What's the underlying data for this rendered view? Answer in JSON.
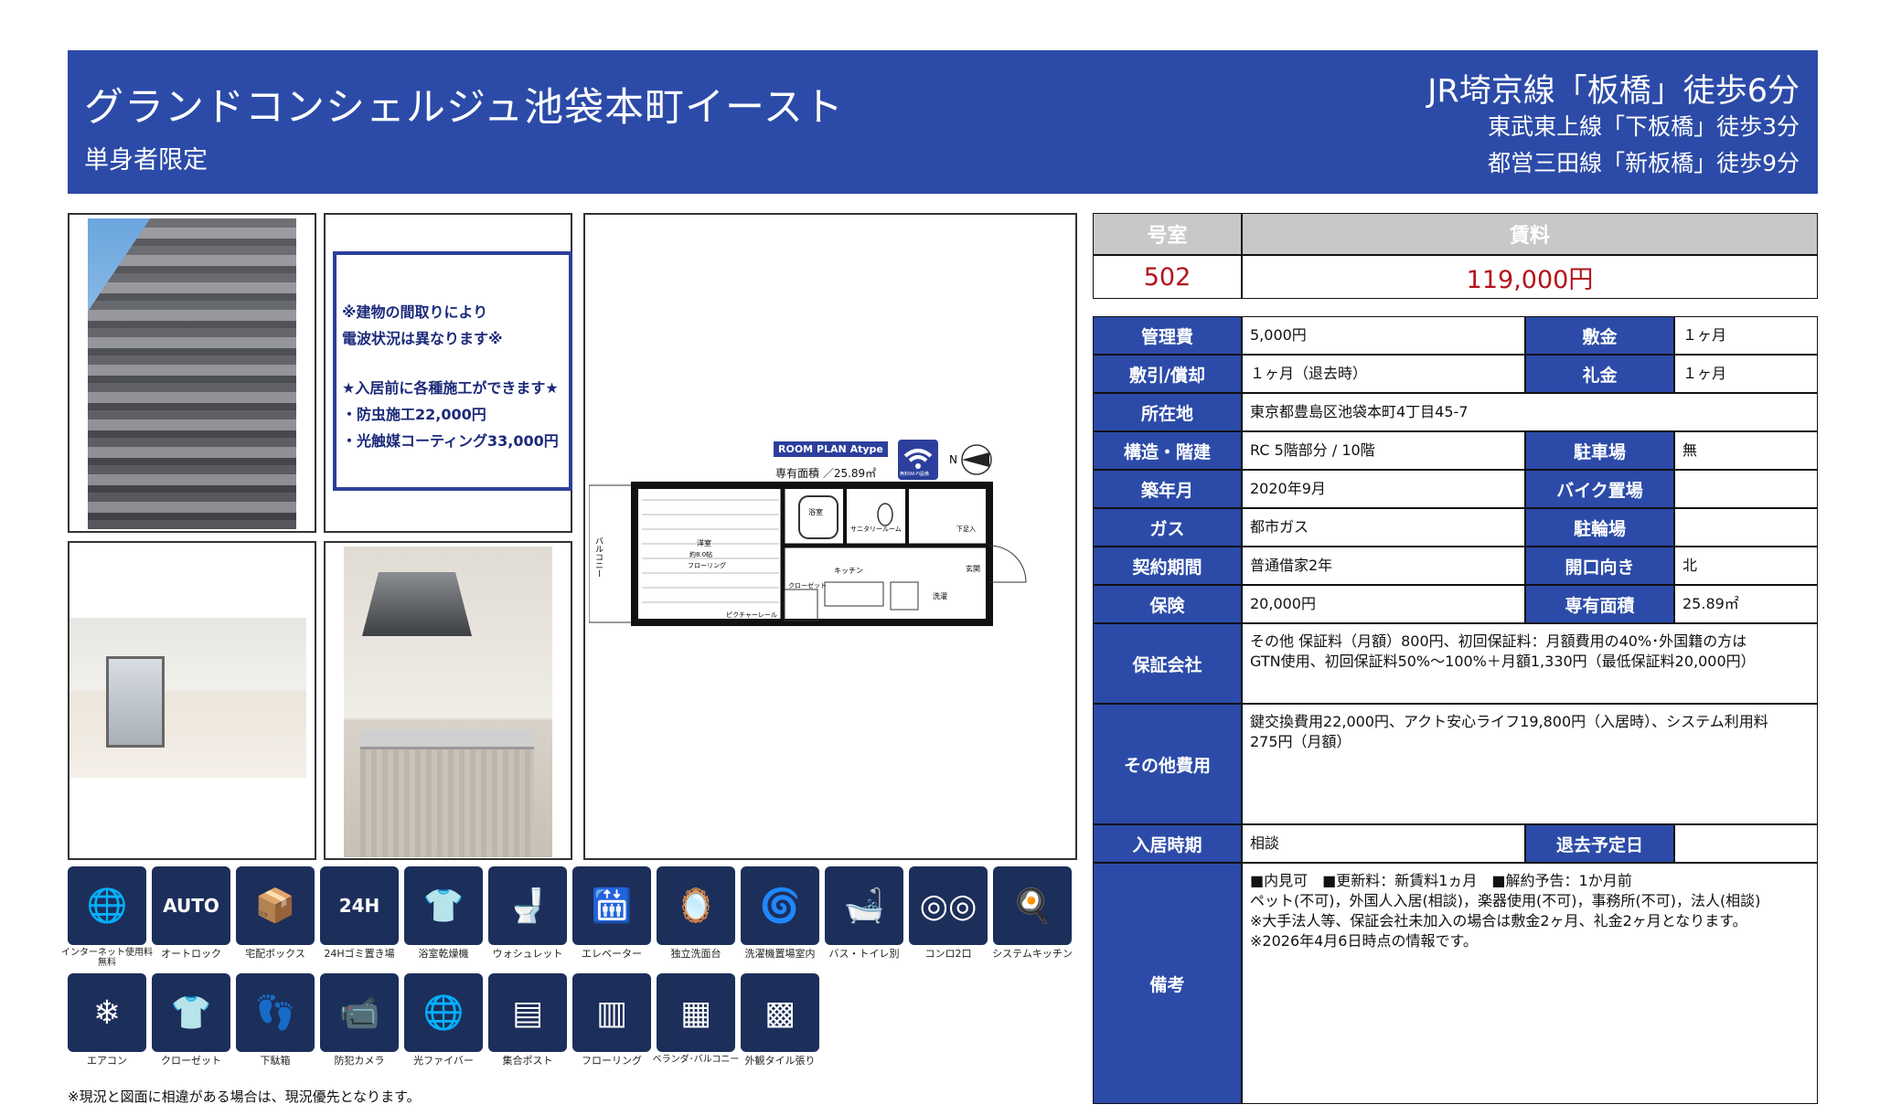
{
  "header": {
    "title": "グランドコンシェルジュ池袋本町イースト",
    "subtitle": "単身者限定",
    "stations": [
      "JR埼京線「板橋」徒歩6分",
      "東武東上線「下板橋」徒歩3分",
      "都営三田線「新板橋」徒歩9分"
    ]
  },
  "notice": {
    "lines": [
      "※建物の間取りにより",
      "電波状況は異なります※",
      "★入居前に各種施工ができます★",
      "・防虫施工22,000円",
      "・光触媒コーティング33,000円"
    ]
  },
  "plan": {
    "tag": "ROOM PLAN  Atype",
    "area": "専有面積 ／25.89㎡",
    "labels": {
      "room": "洋室",
      "room_size": "約8.0帖",
      "flooring": "フローリング",
      "bath": "浴室",
      "sanitary": "サニタリールーム",
      "kitchen": "キッチン",
      "closet": "クローゼット",
      "picture_rail": "ピクチャーレール",
      "balcony": "バルコニー",
      "entrance": "玄関",
      "washer": "洗濯",
      "shoe": "下足入",
      "wifi": "無料Wi-Fi設備"
    }
  },
  "price_table": {
    "room_header": "号室",
    "rent_header": "賃料",
    "room": "502",
    "rent": "119,000円"
  },
  "details": {
    "management_fee": {
      "label": "管理費",
      "value": "5,000円"
    },
    "deposit": {
      "label": "敷金",
      "value": "１ヶ月"
    },
    "shikibiki": {
      "label": "敷引/償却",
      "value": "１ヶ月（退去時）"
    },
    "key_money": {
      "label": "礼金",
      "value": "１ヶ月"
    },
    "address": {
      "label": "所在地",
      "value": "東京都豊島区池袋本町4丁目45-7"
    },
    "structure": {
      "label": "構造・階建",
      "value": "RC 5階部分 / 10階"
    },
    "parking": {
      "label": "駐車場",
      "value": "無"
    },
    "built": {
      "label": "築年月",
      "value": "2020年9月"
    },
    "bike_parking": {
      "label": "バイク置場",
      "value": ""
    },
    "gas": {
      "label": "ガス",
      "value": "都市ガス"
    },
    "bicycle_parking": {
      "label": "駐輪場",
      "value": ""
    },
    "contract": {
      "label": "契約期間",
      "value": "普通借家2年"
    },
    "direction": {
      "label": "開口向き",
      "value": "北"
    },
    "insurance": {
      "label": "保険",
      "value": "20,000円"
    },
    "floor_area": {
      "label": "専有面積",
      "value": "25.89㎡"
    },
    "guarantor": {
      "label": "保証会社",
      "value": "その他 保証料（月額）800円、初回保証料：月額費用の40%･外国籍の方は\nGTN使用、初回保証料50%～100%＋月額1,330円（最低保証料20,000円）"
    },
    "other_fees": {
      "label": "その他費用",
      "value": "鍵交換費用22,000円、アクト安心ライフ19,800円（入居時）、システム利用料\n275円（月額）"
    },
    "move_in": {
      "label": "入居時期",
      "value": "相談"
    },
    "move_out": {
      "label": "退去予定日",
      "value": ""
    },
    "remarks": {
      "label": "備考",
      "value": "■内見可　■更新料：新賃料1ヵ月　■解約予告：1か月前\nペット(不可)，外国人入居(相談)，楽器使用(不可)，事務所(不可)，法人(相談)\n※大手法人等、保証会社未加入の場合は敷金2ヶ月、礼金2ヶ月となります。\n※2026年4月6日時点の情報です。"
    }
  },
  "amenities": [
    {
      "name": "internet-icon",
      "glyph": "🌐",
      "label": "インターネット使用料無料"
    },
    {
      "name": "auto-lock-icon",
      "glyph": "AUTO",
      "label": "オートロック"
    },
    {
      "name": "delivery-box-icon",
      "glyph": "📦",
      "label": "宅配ボックス"
    },
    {
      "name": "garbage-24h-icon",
      "glyph": "24H",
      "label": "24Hゴミ置き場"
    },
    {
      "name": "bathroom-dryer-icon",
      "glyph": "👕",
      "label": "浴室乾燥機"
    },
    {
      "name": "washlet-icon",
      "glyph": "🚽",
      "label": "ウォシュレット"
    },
    {
      "name": "elevator-icon",
      "glyph": "🛗",
      "label": "エレベーター"
    },
    {
      "name": "washbasin-icon",
      "glyph": "🪞",
      "label": "独立洗面台"
    },
    {
      "name": "indoor-washer-icon",
      "glyph": "🌀",
      "label": "洗濯機置場室内"
    },
    {
      "name": "bath-toilet-separate-icon",
      "glyph": "🛁",
      "label": "バス・トイレ別"
    },
    {
      "name": "two-burner-stove-icon",
      "glyph": "◎◎",
      "label": "コンロ2口"
    },
    {
      "name": "system-kitchen-icon",
      "glyph": "🍳",
      "label": "システムキッチン"
    },
    {
      "name": "air-conditioner-icon",
      "glyph": "❄",
      "label": "エアコン"
    },
    {
      "name": "closet-icon",
      "glyph": "👕",
      "label": "クローゼット"
    },
    {
      "name": "shoe-box-icon",
      "glyph": "👣",
      "label": "下駄箱"
    },
    {
      "name": "security-camera-icon",
      "glyph": "📹",
      "label": "防犯カメラ"
    },
    {
      "name": "fiber-optic-icon",
      "glyph": "🌐",
      "label": "光ファイバー"
    },
    {
      "name": "mailbox-icon",
      "glyph": "▤",
      "label": "集合ポスト"
    },
    {
      "name": "flooring-icon",
      "glyph": "▥",
      "label": "フローリング"
    },
    {
      "name": "balcony-icon",
      "glyph": "▦",
      "label": "ベランダ･バルコニー"
    },
    {
      "name": "tile-exterior-icon",
      "glyph": "▩",
      "label": "外観タイル張り"
    }
  ],
  "footnote": "※現況と図面に相違がある場合は、現況優先となります。",
  "colors": {
    "header_blue": "#2c4ba8",
    "price_red": "#b3121a",
    "icon_navy": "#1c2e5a",
    "gray_header": "#c8c8c8"
  }
}
